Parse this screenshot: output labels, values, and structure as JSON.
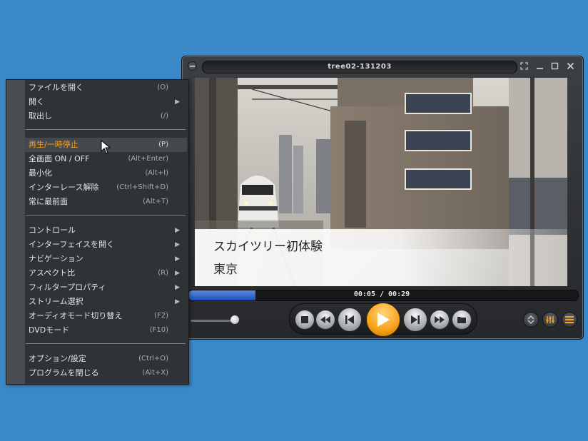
{
  "window": {
    "title": "tree02-131203",
    "controls": [
      "fullscreen-icon",
      "minimize-icon",
      "maximize-icon",
      "close-icon"
    ]
  },
  "video": {
    "caption_title": "スカイツリー初体験",
    "caption_subtitle": "東京"
  },
  "playback": {
    "elapsed": "00:05",
    "total": "00:29",
    "time_separator": " / ",
    "progress": 0.172,
    "volume": 0.9
  },
  "controls": {
    "buttons": [
      "stop-icon",
      "rewind-icon",
      "previous-icon",
      "play-icon",
      "next-icon",
      "fast-forward-icon",
      "open-file-icon"
    ],
    "side_buttons": [
      "up-down-icon",
      "equalizer-icon",
      "playlist-icon"
    ],
    "accent": "#f7a21a"
  },
  "menu": {
    "highlight_color": "#f2a024",
    "items": [
      {
        "label": "ファイルを開く",
        "shortcut": "(O)",
        "submenu": false
      },
      {
        "label": "開く",
        "shortcut": "",
        "submenu": true
      },
      {
        "label": "取出し",
        "shortcut": "(/)",
        "submenu": false
      },
      {
        "label": "再生/一時停止",
        "shortcut": "(P)",
        "submenu": false,
        "highlighted": true
      },
      {
        "label": "全画面 ON / OFF",
        "shortcut": "(Alt+Enter)",
        "submenu": false
      },
      {
        "label": "最小化",
        "shortcut": "(Alt+I)",
        "submenu": false
      },
      {
        "label": "インターレース解除",
        "shortcut": "(Ctrl+Shift+D)",
        "submenu": false
      },
      {
        "label": "常に最前面",
        "shortcut": "(Alt+T)",
        "submenu": false
      },
      {
        "label": "コントロール",
        "shortcut": "",
        "submenu": true
      },
      {
        "label": "インターフェイスを開く",
        "shortcut": "",
        "submenu": true
      },
      {
        "label": "ナビゲーション",
        "shortcut": "",
        "submenu": true
      },
      {
        "label": "アスペクト比",
        "shortcut": "(R)",
        "submenu": true
      },
      {
        "label": "フィルタープロパティ",
        "shortcut": "",
        "submenu": true
      },
      {
        "label": "ストリーム選択",
        "shortcut": "",
        "submenu": true
      },
      {
        "label": "オーディオモード切り替え",
        "shortcut": "(F2)",
        "submenu": false
      },
      {
        "label": "DVDモード",
        "shortcut": "(F10)",
        "submenu": false
      },
      {
        "label": "オプション/設定",
        "shortcut": "(Ctrl+O)",
        "submenu": false
      },
      {
        "label": "プログラムを閉じる",
        "shortcut": "(Alt+X)",
        "submenu": false
      }
    ],
    "submenu_arrow": "▶"
  }
}
